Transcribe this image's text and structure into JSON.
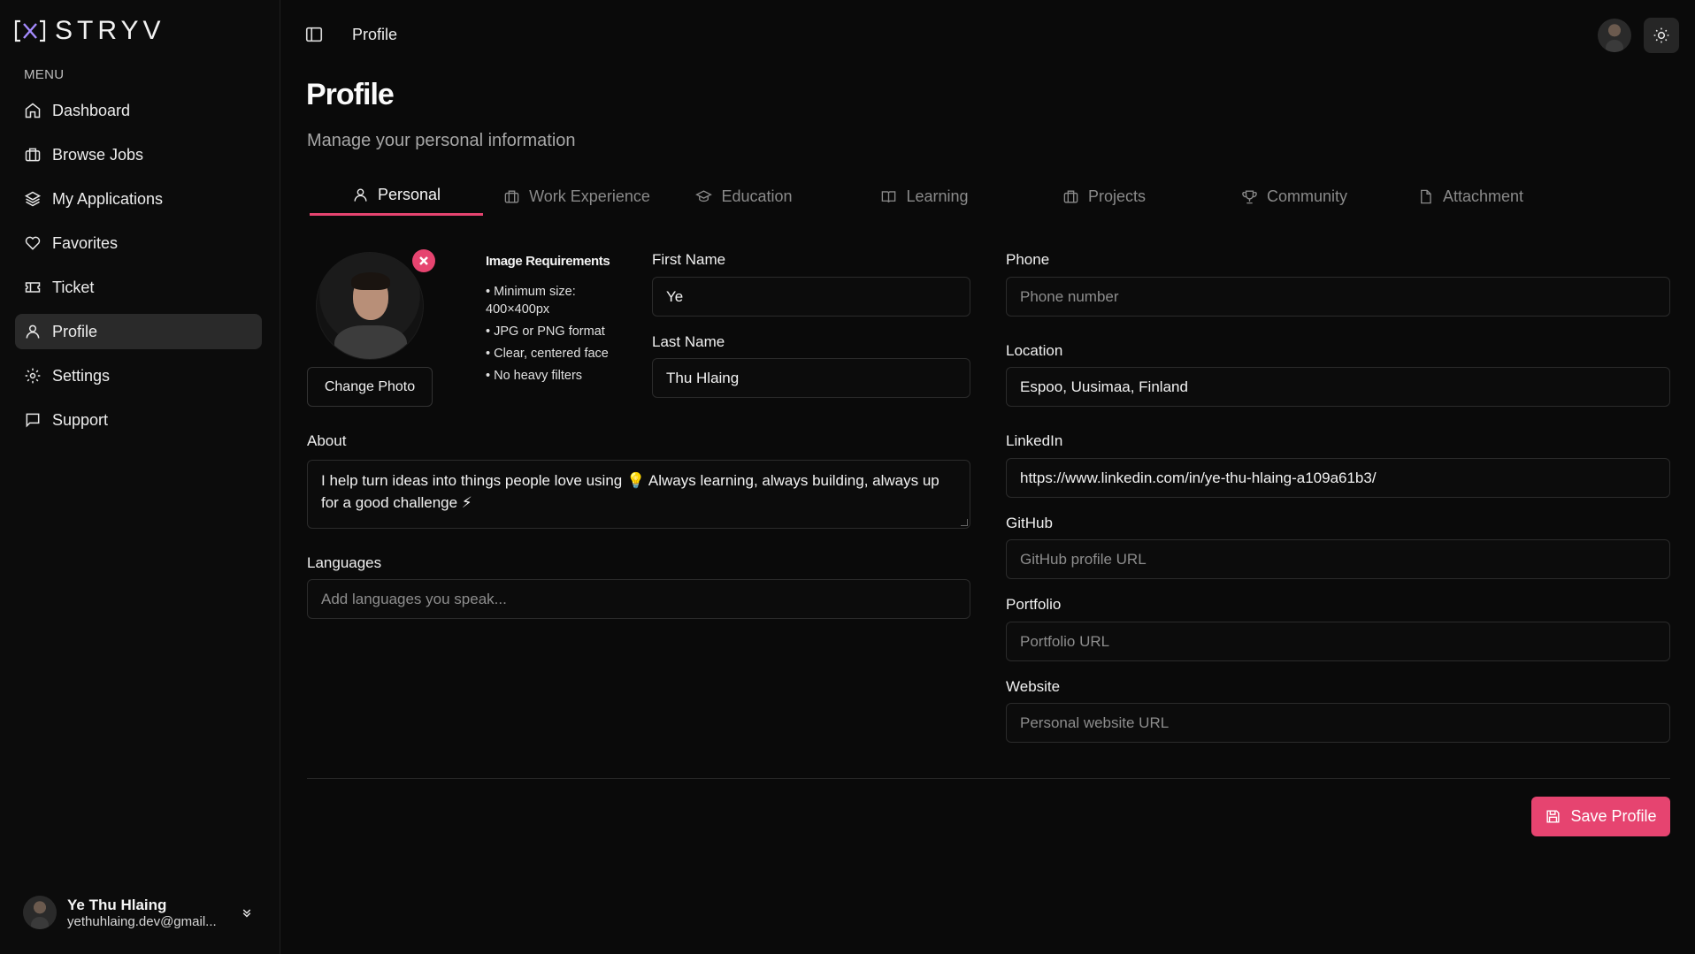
{
  "brand": {
    "name": "STRYV"
  },
  "sidebar": {
    "menu_label": "MENU",
    "items": [
      {
        "label": "Dashboard",
        "icon": "home-icon"
      },
      {
        "label": "Browse Jobs",
        "icon": "briefcase-icon"
      },
      {
        "label": "My Applications",
        "icon": "layers-icon"
      },
      {
        "label": "Favorites",
        "icon": "heart-icon"
      },
      {
        "label": "Ticket",
        "icon": "ticket-icon"
      },
      {
        "label": "Profile",
        "icon": "user-icon",
        "active": true
      },
      {
        "label": "Settings",
        "icon": "gear-icon"
      },
      {
        "label": "Support",
        "icon": "message-icon"
      }
    ],
    "user": {
      "name": "Ye Thu Hlaing",
      "email": "yethuhlaing.dev@gmail..."
    }
  },
  "header": {
    "breadcrumb": "Profile"
  },
  "page": {
    "title": "Profile",
    "subtitle": "Manage your personal information"
  },
  "tabs": [
    {
      "label": "Personal",
      "icon": "user-icon",
      "active": true
    },
    {
      "label": "Work Experience",
      "icon": "briefcase-icon"
    },
    {
      "label": "Education",
      "icon": "graduation-cap-icon"
    },
    {
      "label": "Learning",
      "icon": "book-icon"
    },
    {
      "label": "Projects",
      "icon": "briefcase-icon"
    },
    {
      "label": "Community",
      "icon": "trophy-icon"
    },
    {
      "label": "Attachment",
      "icon": "file-icon"
    }
  ],
  "photo": {
    "change_label": "Change Photo",
    "requirements_title": "Image Requirements",
    "requirements": [
      "• Minimum size: 400×400px",
      "• JPG or PNG format",
      "• Clear, centered face",
      "• No heavy filters"
    ]
  },
  "form": {
    "first_name": {
      "label": "First Name",
      "value": "Ye"
    },
    "last_name": {
      "label": "Last Name",
      "value": "Thu Hlaing"
    },
    "about": {
      "label": "About",
      "value": "I help turn ideas into things people love using 💡 Always learning, always building, always up for a good challenge ⚡"
    },
    "languages": {
      "label": "Languages",
      "placeholder": "Add languages you speak..."
    },
    "phone": {
      "label": "Phone",
      "placeholder": "Phone number"
    },
    "location": {
      "label": "Location",
      "value": "Espoo, Uusimaa, Finland"
    },
    "linkedin": {
      "label": "LinkedIn",
      "value": "https://www.linkedin.com/in/ye-thu-hlaing-a109a61b3/"
    },
    "github": {
      "label": "GitHub",
      "placeholder": "GitHub profile URL"
    },
    "portfolio": {
      "label": "Portfolio",
      "placeholder": "Portfolio URL"
    },
    "website": {
      "label": "Website",
      "placeholder": "Personal website URL"
    }
  },
  "actions": {
    "save_label": "Save Profile"
  },
  "colors": {
    "accent": "#e64470",
    "background": "#0a0a0a",
    "active_nav": "#2a2a2a"
  }
}
